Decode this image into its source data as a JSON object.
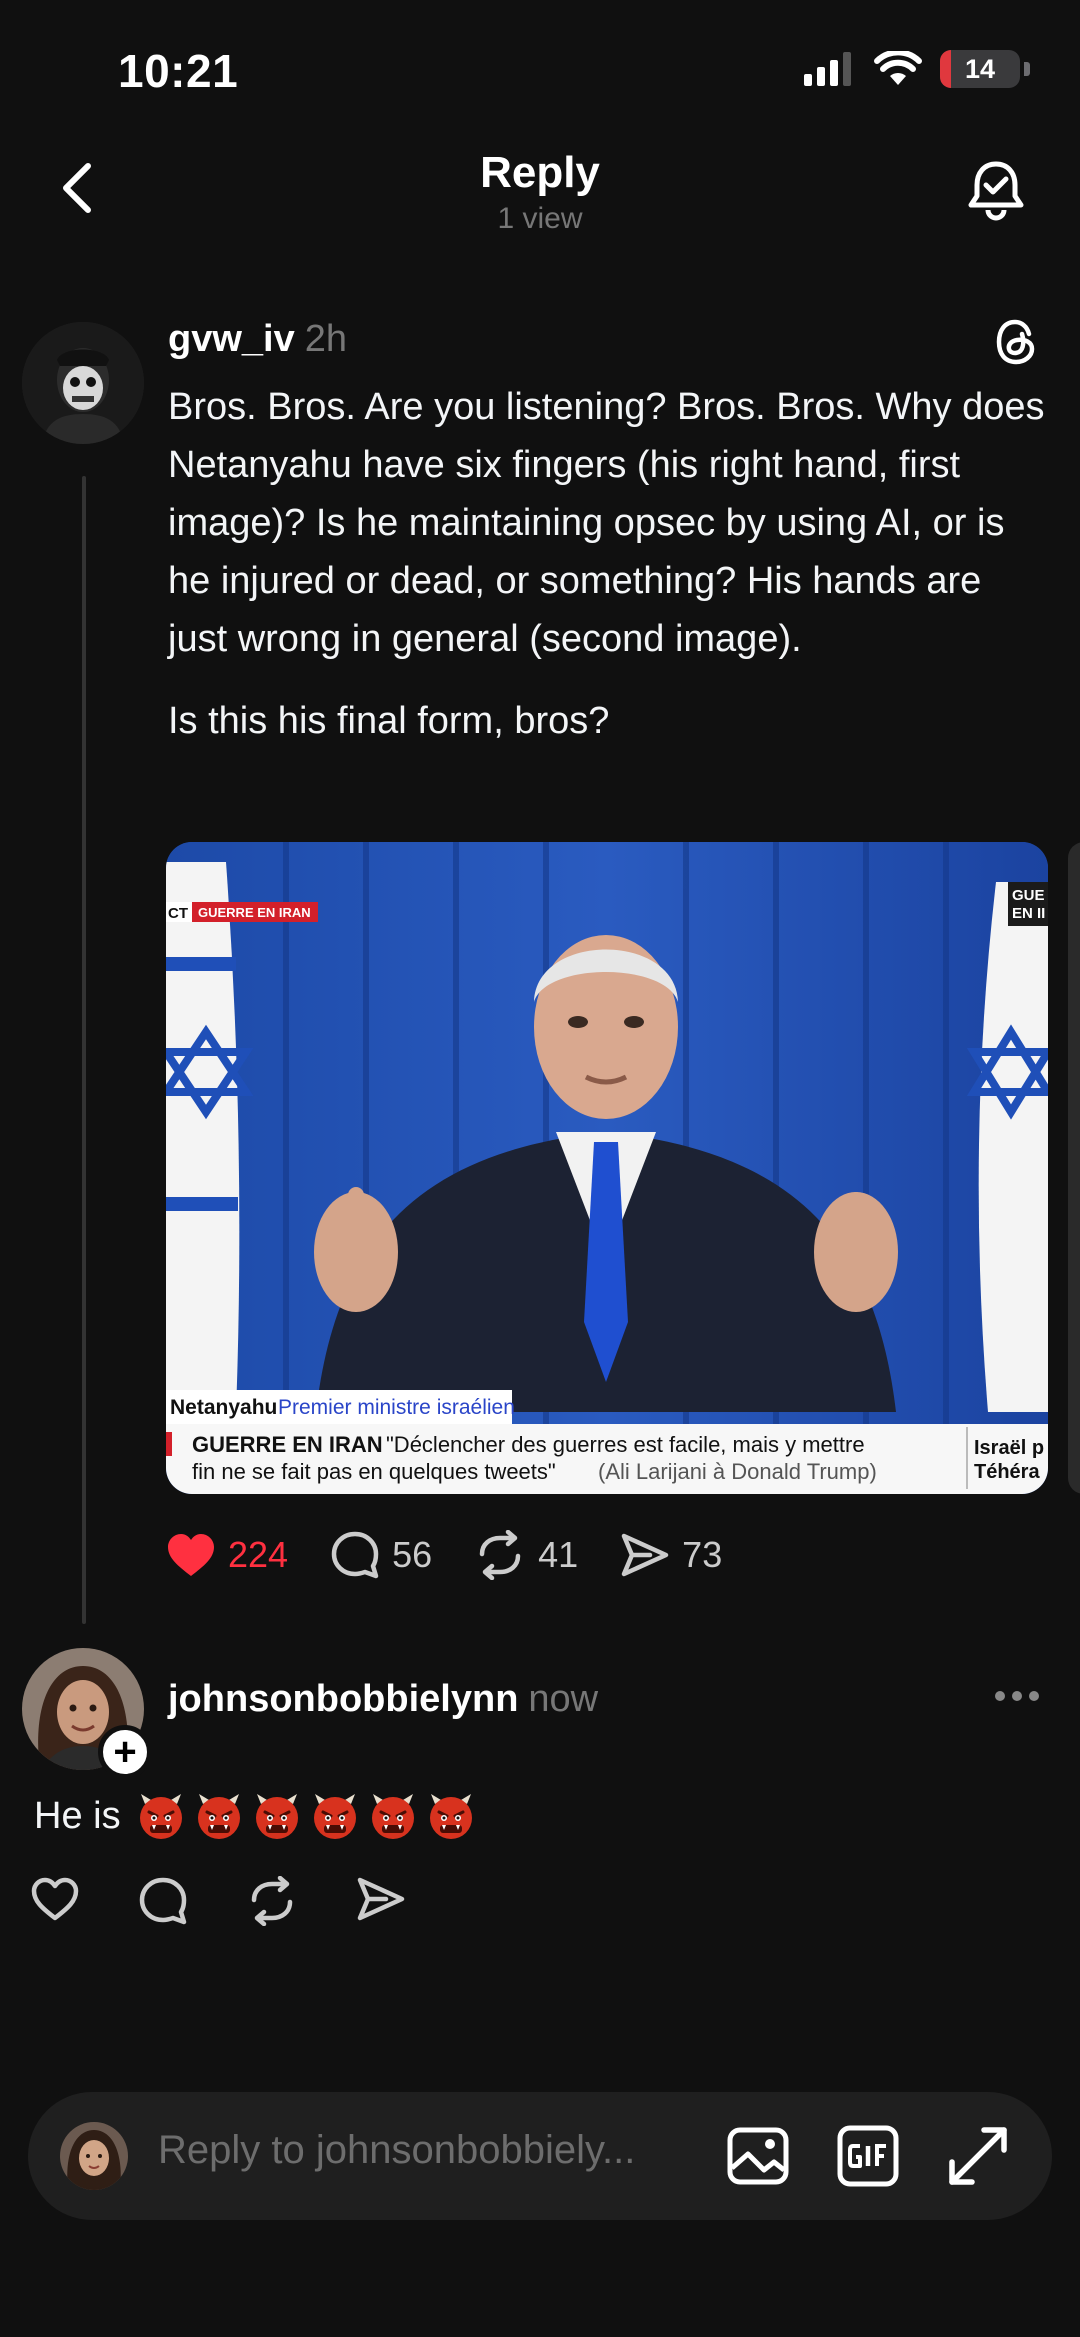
{
  "status_bar": {
    "time": "10:21",
    "battery": "14"
  },
  "header": {
    "title": "Reply",
    "subtitle": "1 view"
  },
  "post": {
    "username": "gvw_iv",
    "time": "2h",
    "paragraph1": "Bros. Bros. Are you listening? Bros. Bros. Why does Netanyahu have six fingers (his right hand, first image)? Is he maintaining opsec by using AI, or is he injured or dead, or something? His hands are just wrong in general (second image).",
    "paragraph2": "Is this his final form, bros?",
    "image": {
      "tag_left": "CT",
      "tag_red": "GUERRE EN IRAN",
      "corner_top": "GUE",
      "corner_bottom": "EN II",
      "name": "Netanyahu",
      "role": "Premier ministre israélien",
      "ticker_head": "GUERRE EN IRAN",
      "ticker_quote1": "\"Déclencher des guerres est facile, mais y mettre",
      "ticker_quote2": "fin ne se fait pas en quelques tweets\"",
      "ticker_credit": "(Ali Larijani à Donald Trump)",
      "side1": "Israël p",
      "side2": "Téhéra"
    },
    "likes": "224",
    "comments": "56",
    "reposts": "41",
    "shares": "73",
    "like_color": "#ff3040"
  },
  "reply": {
    "username": "johnsonbobbielynn",
    "time": "now",
    "text": "He is",
    "emoji_count": 6,
    "emoji_name": "ogre-emoji"
  },
  "composer": {
    "placeholder": "Reply to johnsonbobbiely..."
  },
  "icons": [
    "back-icon",
    "bell-check-icon",
    "threads-icon",
    "heart-icon",
    "comment-icon",
    "repost-icon",
    "share-icon",
    "more-icon",
    "image-icon",
    "gif-icon",
    "expand-icon"
  ]
}
